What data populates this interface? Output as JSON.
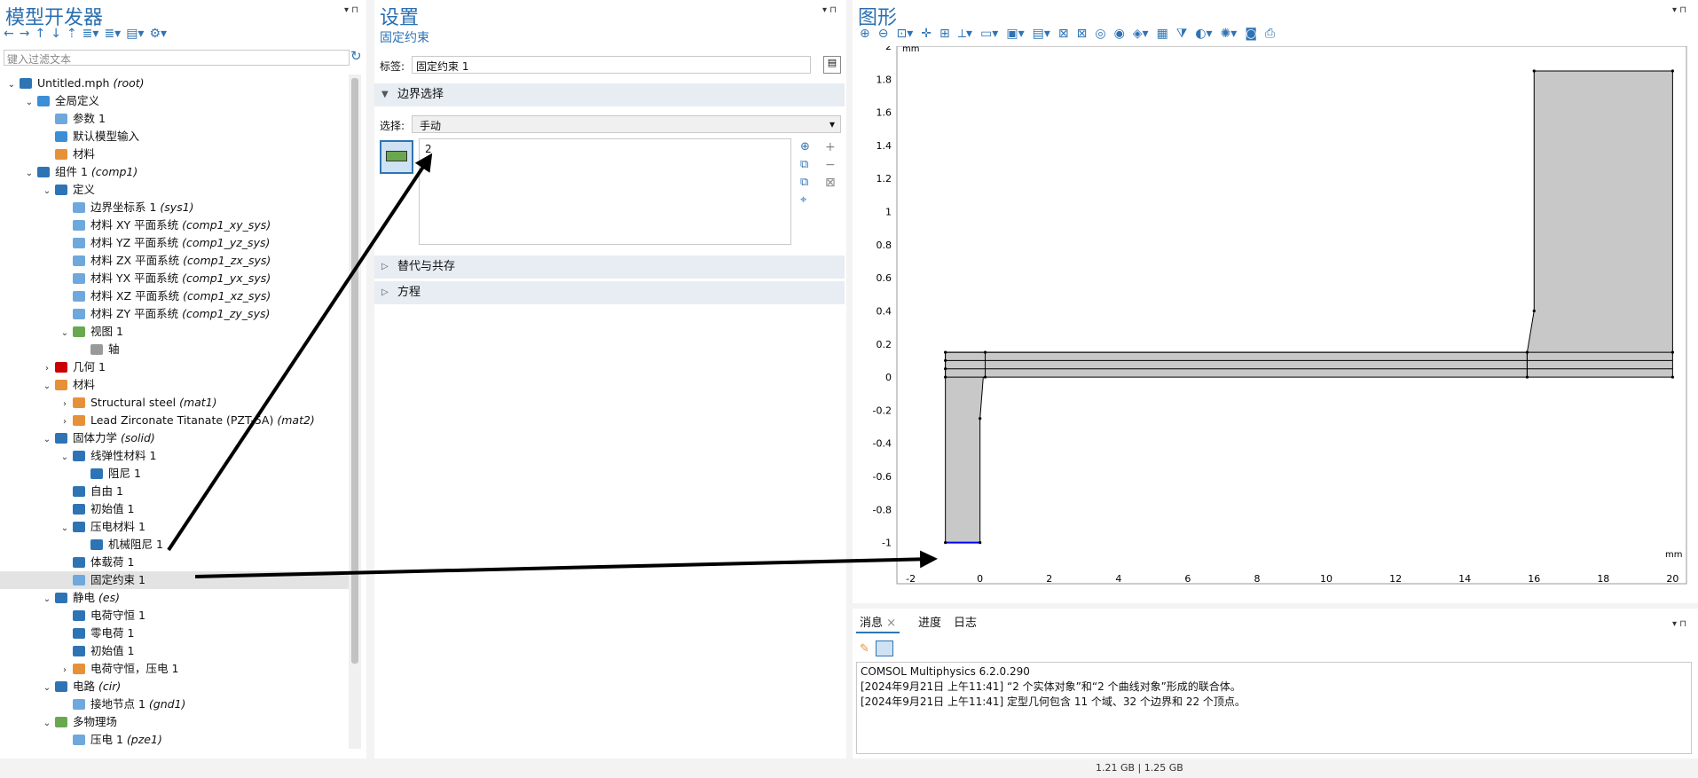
{
  "left": {
    "title": "模型开发器",
    "filter_placeholder": "键入过滤文本",
    "tree": [
      {
        "indent": 0,
        "toggle": "v",
        "icon": "#2e74b5",
        "label": "Untitled.mph",
        "italic": "(root)"
      },
      {
        "indent": 1,
        "toggle": "v",
        "icon": "#3a8fd6",
        "label": "全局定义",
        "italic": ""
      },
      {
        "indent": 2,
        "toggle": "",
        "icon": "#6fa8dc",
        "label": "参数 1",
        "italic": ""
      },
      {
        "indent": 2,
        "toggle": "",
        "icon": "#3a8fd6",
        "label": "默认模型输入",
        "italic": ""
      },
      {
        "indent": 2,
        "toggle": "",
        "icon": "#e69138",
        "label": "材料",
        "italic": ""
      },
      {
        "indent": 1,
        "toggle": "v",
        "icon": "#2e74b5",
        "label": "组件 1",
        "italic": "(comp1)"
      },
      {
        "indent": 2,
        "toggle": "v",
        "icon": "#2e74b5",
        "label": "定义",
        "italic": ""
      },
      {
        "indent": 3,
        "toggle": "",
        "icon": "#6fa8dc",
        "label": "边界坐标系 1",
        "italic": "(sys1)"
      },
      {
        "indent": 3,
        "toggle": "",
        "icon": "#6fa8dc",
        "label": "材料 XY 平面系统",
        "italic": "(comp1_xy_sys)"
      },
      {
        "indent": 3,
        "toggle": "",
        "icon": "#6fa8dc",
        "label": "材料 YZ 平面系统",
        "italic": "(comp1_yz_sys)"
      },
      {
        "indent": 3,
        "toggle": "",
        "icon": "#6fa8dc",
        "label": "材料 ZX 平面系统",
        "italic": "(comp1_zx_sys)"
      },
      {
        "indent": 3,
        "toggle": "",
        "icon": "#6fa8dc",
        "label": "材料 YX 平面系统",
        "italic": "(comp1_yx_sys)"
      },
      {
        "indent": 3,
        "toggle": "",
        "icon": "#6fa8dc",
        "label": "材料 XZ 平面系统",
        "italic": "(comp1_xz_sys)"
      },
      {
        "indent": 3,
        "toggle": "",
        "icon": "#6fa8dc",
        "label": "材料 ZY 平面系统",
        "italic": "(comp1_zy_sys)"
      },
      {
        "indent": 3,
        "toggle": "v",
        "icon": "#6aa84f",
        "label": "视图 1",
        "italic": ""
      },
      {
        "indent": 4,
        "toggle": "",
        "icon": "#999999",
        "label": "轴",
        "italic": ""
      },
      {
        "indent": 2,
        "toggle": ">",
        "icon": "#cc0000",
        "label": "几何 1",
        "italic": ""
      },
      {
        "indent": 2,
        "toggle": "v",
        "icon": "#e69138",
        "label": "材料",
        "italic": ""
      },
      {
        "indent": 3,
        "toggle": ">",
        "icon": "#e69138",
        "label": "Structural steel",
        "italic": "(mat1)"
      },
      {
        "indent": 3,
        "toggle": ">",
        "icon": "#e69138",
        "label": "Lead Zirconate Titanate (PZT-5A)",
        "italic": "(mat2)"
      },
      {
        "indent": 2,
        "toggle": "v",
        "icon": "#2e74b5",
        "label": "固体力学",
        "italic": "(solid)"
      },
      {
        "indent": 3,
        "toggle": "v",
        "icon": "#2e74b5",
        "label": "线弹性材料 1",
        "italic": ""
      },
      {
        "indent": 4,
        "toggle": "",
        "icon": "#2e74b5",
        "label": "阻尼 1",
        "italic": ""
      },
      {
        "indent": 3,
        "toggle": "",
        "icon": "#2e74b5",
        "label": "自由 1",
        "italic": ""
      },
      {
        "indent": 3,
        "toggle": "",
        "icon": "#2e74b5",
        "label": "初始值 1",
        "italic": ""
      },
      {
        "indent": 3,
        "toggle": "v",
        "icon": "#2e74b5",
        "label": "压电材料 1",
        "italic": ""
      },
      {
        "indent": 4,
        "toggle": "",
        "icon": "#2e74b5",
        "label": "机械阻尼 1",
        "italic": ""
      },
      {
        "indent": 3,
        "toggle": "",
        "icon": "#2e74b5",
        "label": "体载荷 1",
        "italic": ""
      },
      {
        "indent": 3,
        "toggle": "",
        "icon": "#6fa8dc",
        "label": "固定约束 1",
        "italic": "",
        "selected": true
      },
      {
        "indent": 2,
        "toggle": "v",
        "icon": "#2e74b5",
        "label": "静电",
        "italic": "(es)"
      },
      {
        "indent": 3,
        "toggle": "",
        "icon": "#2e74b5",
        "label": "电荷守恒 1",
        "italic": ""
      },
      {
        "indent": 3,
        "toggle": "",
        "icon": "#2e74b5",
        "label": "零电荷 1",
        "italic": ""
      },
      {
        "indent": 3,
        "toggle": "",
        "icon": "#2e74b5",
        "label": "初始值 1",
        "italic": ""
      },
      {
        "indent": 3,
        "toggle": ">",
        "icon": "#e69138",
        "label": "电荷守恒，压电 1",
        "italic": ""
      },
      {
        "indent": 2,
        "toggle": "v",
        "icon": "#2e74b5",
        "label": "电路",
        "italic": "(cir)"
      },
      {
        "indent": 3,
        "toggle": "",
        "icon": "#6fa8dc",
        "label": "接地节点 1",
        "italic": "(gnd1)"
      },
      {
        "indent": 2,
        "toggle": "v",
        "icon": "#6aa84f",
        "label": "多物理场",
        "italic": ""
      },
      {
        "indent": 3,
        "toggle": "",
        "icon": "#6fa8dc",
        "label": "压电 1",
        "italic": "(pze1)"
      }
    ]
  },
  "mid": {
    "title": "设置",
    "subtitle": "固定约束",
    "label_caption": "标签:",
    "label_value": "固定约束 1",
    "section_boundary": "边界选择",
    "select_caption": "选择:",
    "select_value": "手动",
    "selection_item": "2",
    "section_override": "替代与共存",
    "section_equation": "方程"
  },
  "graphics": {
    "title": "图形",
    "unit": "mm",
    "x_ticks": [
      "-2",
      "0",
      "2",
      "4",
      "6",
      "8",
      "10",
      "12",
      "14",
      "16",
      "18",
      "20"
    ],
    "y_ticks": [
      "2",
      "1.8",
      "1.6",
      "1.4",
      "1.2",
      "1",
      "0.8",
      "0.6",
      "0.4",
      "0.2",
      "0",
      "-0.2",
      "-0.4",
      "-0.6",
      "-0.8",
      "-1"
    ],
    "fill": "#c8c8c8",
    "highlight": "#0000ff"
  },
  "messages": {
    "tabs": [
      "消息",
      "进度",
      "日志"
    ],
    "lines": [
      "COMSOL Multiphysics 6.2.0.290",
      "[2024年9月21日 上午11:41] “2 个实体对象”和“2 个曲线对象”形成的联合体。",
      "[2024年9月21日 上午11:41] 定型几何包含 11 个域、32 个边界和 22 个顶点。"
    ]
  },
  "status": {
    "memory": "1.21 GB | 1.25 GB"
  }
}
